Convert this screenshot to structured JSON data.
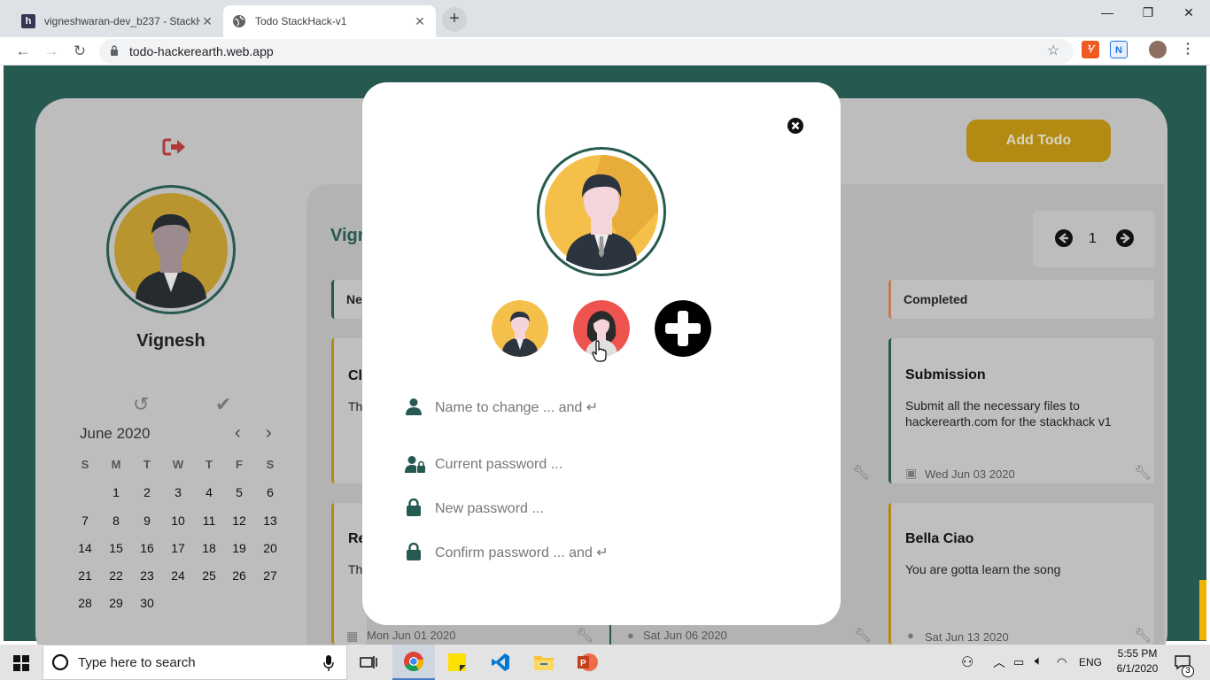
{
  "browser": {
    "tabs": [
      {
        "title": "vigneshwaran-dev_b237 - StackHack",
        "favicon": "h"
      },
      {
        "title": "Todo StackHack-v1",
        "favicon": "globe"
      }
    ],
    "url": "todo-hackerearth.web.app"
  },
  "app": {
    "username": "Vignesh",
    "add_todo_label": "Add Todo",
    "page_number": "1",
    "section_title": "Vign",
    "calendar": {
      "title": "June 2020",
      "weekdays": [
        "S",
        "M",
        "T",
        "W",
        "T",
        "F",
        "S"
      ],
      "days": [
        "1",
        "2",
        "3",
        "4",
        "5",
        "6",
        "7",
        "8",
        "9",
        "10",
        "11",
        "12",
        "13",
        "14",
        "15",
        "16",
        "17",
        "18",
        "19",
        "20",
        "21",
        "22",
        "23",
        "24",
        "25",
        "26",
        "27",
        "28",
        "29",
        "30"
      ]
    },
    "columns": [
      {
        "label": "Ne"
      },
      {
        "label": "Completed"
      }
    ],
    "todos": [
      {
        "title": "Cl",
        "desc": "Th",
        "date": ""
      },
      {
        "title": "Submission",
        "desc": "Submit all the necessary files to hackerearth.com for the stackhack v1",
        "date": "Wed Jun 03 2020"
      },
      {
        "title": "Re",
        "desc": "Thi",
        "date": "Mon Jun 01 2020"
      },
      {
        "title": "",
        "desc": "",
        "date": "Sat Jun 06 2020"
      },
      {
        "title": "Bella Ciao",
        "desc": "You are gotta learn the song",
        "date": "Sat Jun 13 2020"
      }
    ]
  },
  "modal": {
    "name_placeholder": "Name to change ... and ↵",
    "current_password_placeholder": "Current password ...",
    "new_password_placeholder": "New password ...",
    "confirm_password_placeholder": "Confirm password ... and ↵"
  },
  "taskbar": {
    "search_placeholder": "Type here to search",
    "language": "ENG",
    "time": "5:55 PM",
    "date": "6/1/2020",
    "notifications": "3"
  },
  "colors": {
    "teal": "#26594f",
    "gold": "#f0b400",
    "red": "#e53935"
  }
}
